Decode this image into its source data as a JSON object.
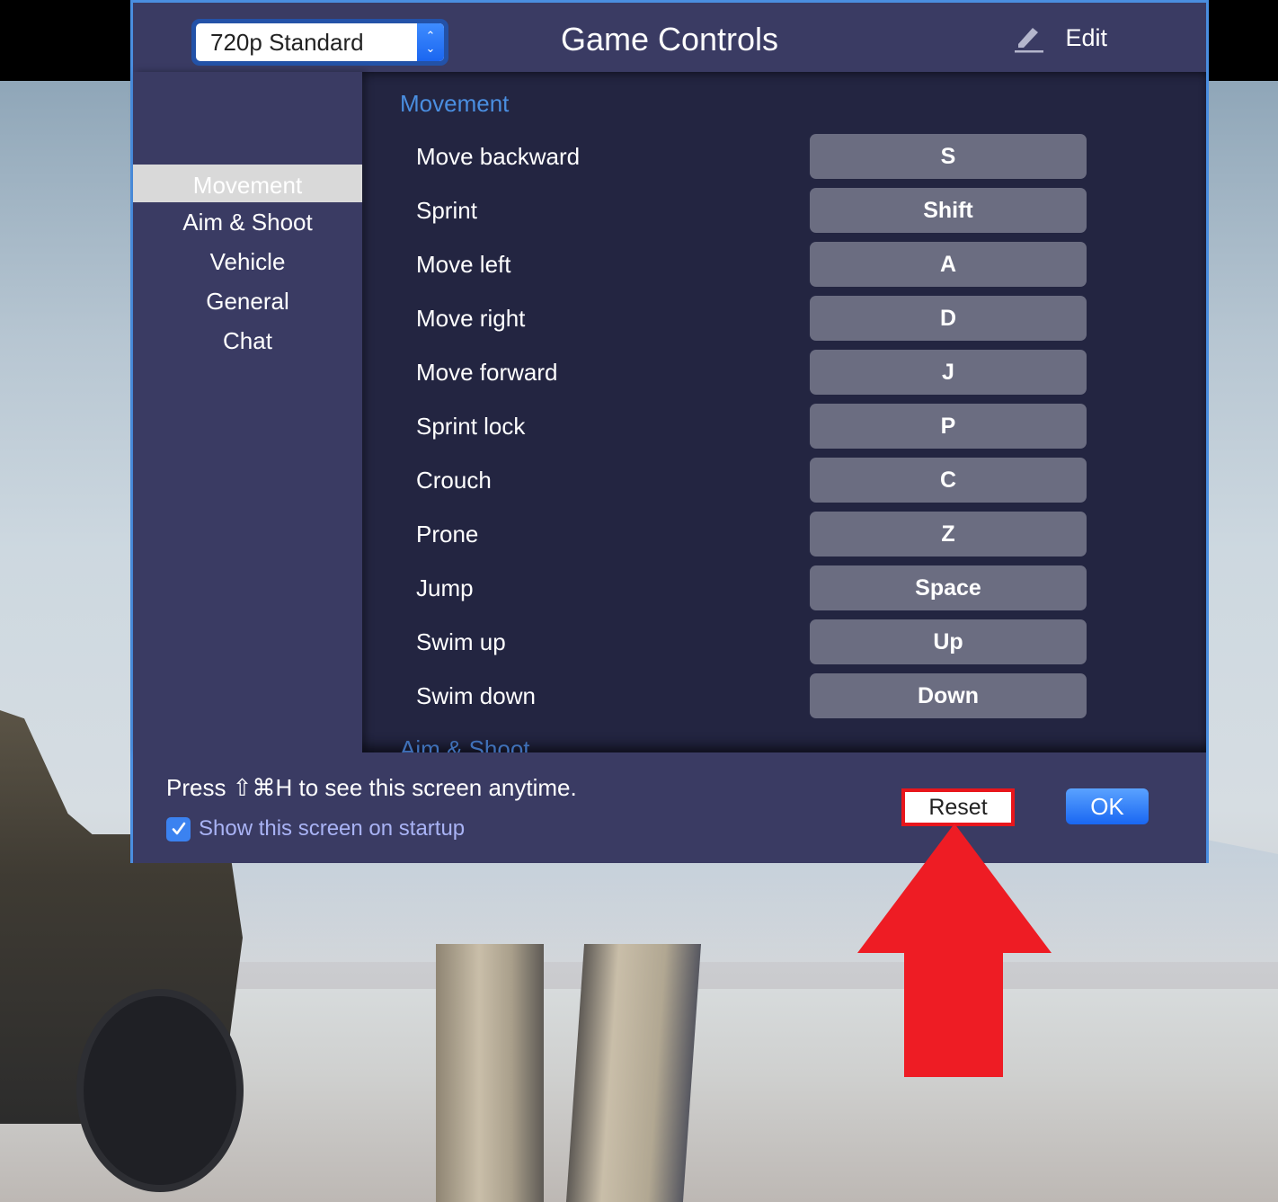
{
  "header": {
    "preset_value": "720p Standard",
    "title": "Game Controls",
    "edit_label": "Edit"
  },
  "sidebar": {
    "items": [
      {
        "label": "Movement",
        "active": true
      },
      {
        "label": "Aim & Shoot",
        "active": false
      },
      {
        "label": "Vehicle",
        "active": false
      },
      {
        "label": "General",
        "active": false
      },
      {
        "label": "Chat",
        "active": false
      }
    ]
  },
  "main": {
    "section_title": "Movement",
    "next_section_title": "Aim & Shoot",
    "bindings": [
      {
        "action": "Move backward",
        "key": "S"
      },
      {
        "action": "Sprint",
        "key": "Shift"
      },
      {
        "action": "Move left",
        "key": "A"
      },
      {
        "action": "Move right",
        "key": "D"
      },
      {
        "action": "Move forward",
        "key": "J"
      },
      {
        "action": "Sprint lock",
        "key": "P"
      },
      {
        "action": "Crouch",
        "key": "C"
      },
      {
        "action": "Prone",
        "key": "Z"
      },
      {
        "action": "Jump",
        "key": "Space"
      },
      {
        "action": "Swim up",
        "key": "Up"
      },
      {
        "action": "Swim down",
        "key": "Down"
      }
    ]
  },
  "footer": {
    "hint": "Press ⇧⌘H to see this screen anytime.",
    "startup_label": "Show this screen on startup",
    "startup_checked": true,
    "reset_label": "Reset",
    "ok_label": "OK"
  },
  "colors": {
    "accent": "#4a8ee0",
    "highlight_box": "#e8161c",
    "annotation_arrow": "#ee1c24"
  }
}
